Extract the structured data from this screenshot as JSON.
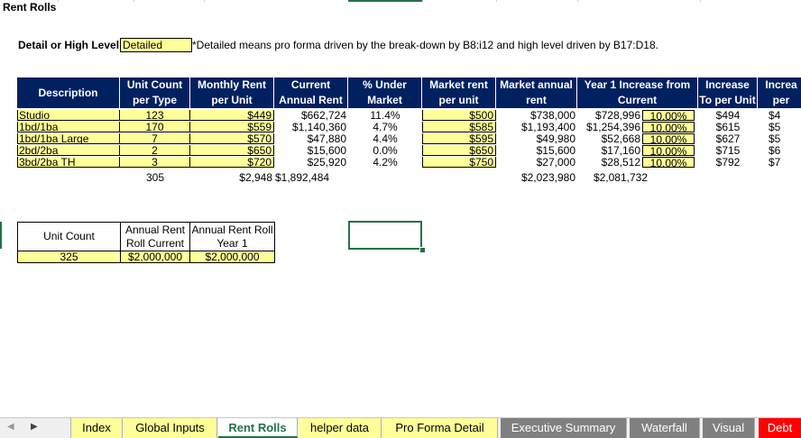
{
  "sheet": {
    "title": "Rent Rolls"
  },
  "detail": {
    "label": "Detail or High Level:",
    "value": "Detailed",
    "note": "*Detailed means pro forma driven by the break-down by B8:i12 and high level driven by B17:D18."
  },
  "table": {
    "headers": [
      "Description",
      "Unit Count per Type",
      "Monthly Rent per Unit",
      "Current Annual Rent",
      "% Under Market",
      "Market rent per unit",
      "Market annual rent",
      "Year 1 Increase from Current",
      "Increase To per Unit",
      "Increa per"
    ],
    "rows": [
      {
        "desc": "Studio",
        "units": "123",
        "monthly": "$449",
        "annual": "$662,724",
        "under": "11.4%",
        "mkt_unit": "$500",
        "mkt_annual": "$738,000",
        "y1": "$728,996",
        "y1_pct": "10.00%",
        "inc_unit": "$494",
        "inc_per": "$4"
      },
      {
        "desc": "1bd/1ba",
        "units": "170",
        "monthly": "$559",
        "annual": "$1,140,360",
        "under": "4.7%",
        "mkt_unit": "$585",
        "mkt_annual": "$1,193,400",
        "y1": "$1,254,396",
        "y1_pct": "10.00%",
        "inc_unit": "$615",
        "inc_per": "$5"
      },
      {
        "desc": "1bd/1ba Large",
        "units": "7",
        "monthly": "$570",
        "annual": "$47,880",
        "under": "4.4%",
        "mkt_unit": "$595",
        "mkt_annual": "$49,980",
        "y1": "$52,668",
        "y1_pct": "10.00%",
        "inc_unit": "$627",
        "inc_per": "$5"
      },
      {
        "desc": "2bd/2ba",
        "units": "2",
        "monthly": "$650",
        "annual": "$15,600",
        "under": "0.0%",
        "mkt_unit": "$650",
        "mkt_annual": "$15,600",
        "y1": "$17,160",
        "y1_pct": "10.00%",
        "inc_unit": "$715",
        "inc_per": "$6"
      },
      {
        "desc": "3bd/2ba TH",
        "units": "3",
        "monthly": "$720",
        "annual": "$25,920",
        "under": "4.2%",
        "mkt_unit": "$750",
        "mkt_annual": "$27,000",
        "y1": "$28,512",
        "y1_pct": "10.00%",
        "inc_unit": "$792",
        "inc_per": "$7"
      }
    ],
    "totals": {
      "units": "305",
      "monthly": "$2,948",
      "annual": "$1,892,484",
      "mkt_annual": "$2,023,980",
      "y1": "$2,081,732"
    }
  },
  "summary": {
    "unit_count_label": "Unit Count",
    "rent_current_label": "Annual Rent Roll Current",
    "rent_y1_label": "Annual Rent Roll Year 1",
    "unit_count": "325",
    "rent_current": "$2,000,000",
    "rent_y1": "$2,000,000"
  },
  "tabs": {
    "items": [
      "Index",
      "Global Inputs",
      "Rent Rolls",
      "helper data",
      "Pro Forma Detail",
      "Executive Summary",
      "Waterfall",
      "Visual",
      "Debt"
    ],
    "active": "Rent Rolls"
  },
  "colors": {
    "header_bg": "#002060",
    "input_fill": "#ffff99",
    "excel_green": "#217346",
    "tab_gray": "#808080",
    "tab_red": "#ff0000"
  }
}
